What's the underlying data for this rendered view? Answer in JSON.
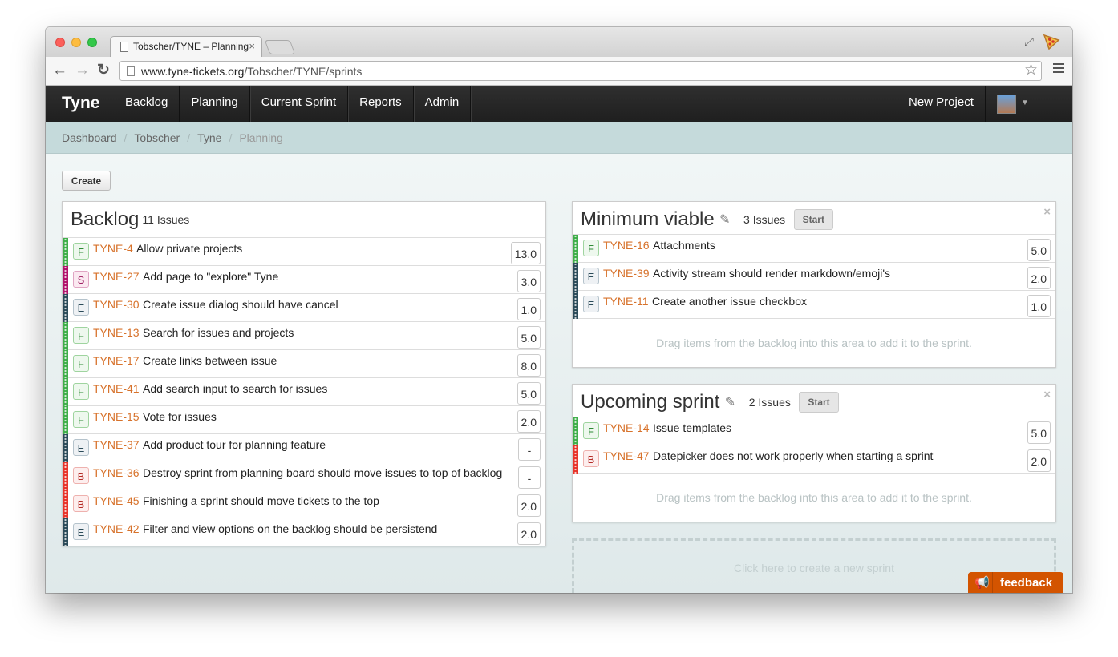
{
  "browser": {
    "tab_title": "Tobscher/TYNE – Planning",
    "tab_close": "×",
    "url_host": "www.tyne-tickets.org",
    "url_path": "/Tobscher/TYNE/sprints",
    "back": "←",
    "forward": "→",
    "reload": "↻",
    "star": "☆",
    "resize": "⤢"
  },
  "navbar": {
    "brand": "Tyne",
    "links": [
      "Backlog",
      "Planning",
      "Current Sprint",
      "Reports",
      "Admin"
    ],
    "new_project": "New Project",
    "caret": "▼"
  },
  "breadcrumb": [
    "Dashboard",
    "Tobscher",
    "Tyne",
    "Planning"
  ],
  "breadcrumb_sep": "/",
  "create_label": "Create",
  "colors": {
    "feature": "#3fae49",
    "story": "#b1106a",
    "enhancement": "#2b4b59",
    "bug": "#e8332a",
    "key": "#d7722b"
  },
  "backlog": {
    "title": "Backlog",
    "count": "11 Issues",
    "issues": [
      {
        "type": "F",
        "key": "TYNE-4",
        "title": "Allow private projects",
        "points": "13.0"
      },
      {
        "type": "S",
        "key": "TYNE-27",
        "title": "Add page to \"explore\" Tyne",
        "points": "3.0"
      },
      {
        "type": "E",
        "key": "TYNE-30",
        "title": "Create issue dialog should have cancel",
        "points": "1.0"
      },
      {
        "type": "F",
        "key": "TYNE-13",
        "title": "Search for issues and projects",
        "points": "5.0"
      },
      {
        "type": "F",
        "key": "TYNE-17",
        "title": "Create links between issue",
        "points": "8.0"
      },
      {
        "type": "F",
        "key": "TYNE-41",
        "title": "Add search input to search for issues",
        "points": "5.0"
      },
      {
        "type": "F",
        "key": "TYNE-15",
        "title": "Vote for issues",
        "points": "2.0"
      },
      {
        "type": "E",
        "key": "TYNE-37",
        "title": "Add product tour for planning feature",
        "points": "-"
      },
      {
        "type": "B",
        "key": "TYNE-36",
        "title": "Destroy sprint from planning board should move issues to top of backlog",
        "points": "-"
      },
      {
        "type": "B",
        "key": "TYNE-45",
        "title": "Finishing a sprint should move tickets to the top",
        "points": "2.0"
      },
      {
        "type": "E",
        "key": "TYNE-42",
        "title": "Filter and view options on the backlog should be persistend",
        "points": "2.0"
      }
    ]
  },
  "sprints": [
    {
      "title": "Minimum viable",
      "count": "3 Issues",
      "start": "Start",
      "close": "×",
      "edit_icon": "✎",
      "issues": [
        {
          "type": "F",
          "key": "TYNE-16",
          "title": "Attachments",
          "points": "5.0"
        },
        {
          "type": "E",
          "key": "TYNE-39",
          "title": "Activity stream should render markdown/emoji's",
          "points": "2.0"
        },
        {
          "type": "E",
          "key": "TYNE-11",
          "title": "Create another issue checkbox",
          "points": "1.0"
        }
      ],
      "drop_text": "Drag items from the backlog into this area to add it to the sprint."
    },
    {
      "title": "Upcoming sprint",
      "count": "2 Issues",
      "start": "Start",
      "close": "×",
      "edit_icon": "✎",
      "issues": [
        {
          "type": "F",
          "key": "TYNE-14",
          "title": "Issue templates",
          "points": "5.0"
        },
        {
          "type": "B",
          "key": "TYNE-47",
          "title": "Datepicker does not work properly when starting a sprint",
          "points": "2.0"
        }
      ],
      "drop_text": "Drag items from the backlog into this area to add it to the sprint."
    }
  ],
  "new_sprint_text": "Click here to create a new sprint",
  "feedback": {
    "label": "feedback",
    "icon": "📢"
  }
}
